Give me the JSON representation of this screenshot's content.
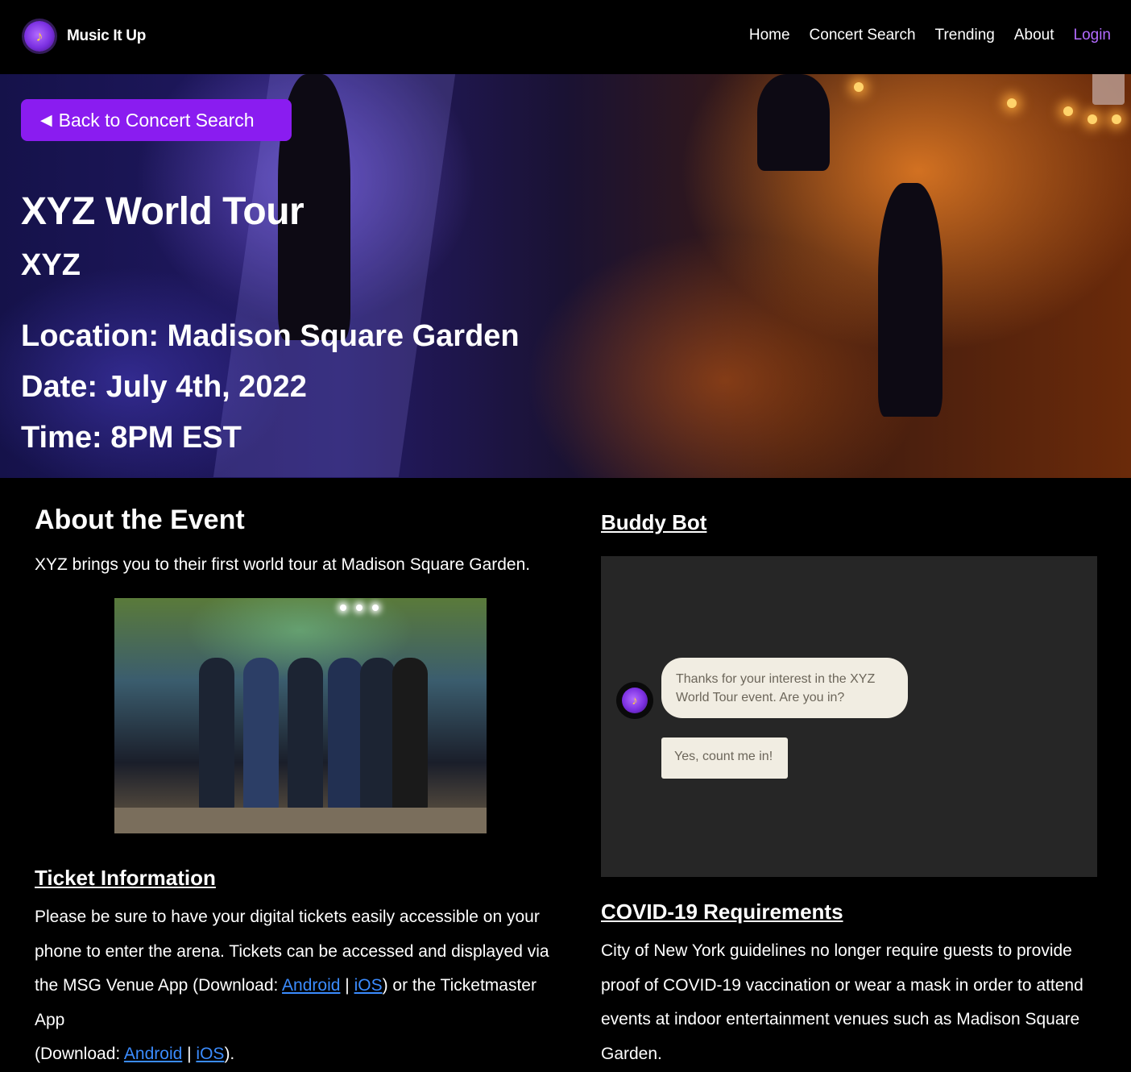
{
  "nav": {
    "brand": "Music It Up",
    "logo_icon": "music-note-icon",
    "links": [
      "Home",
      "Concert Search",
      "Trending",
      "About"
    ],
    "login": "Login"
  },
  "hero": {
    "back_button": "Back to Concert Search",
    "title": "XYZ World Tour",
    "artist": "XYZ",
    "location": "Location: Madison Square Garden",
    "date": "Date: July 4th, 2022",
    "time": "Time: 8PM EST"
  },
  "about": {
    "title": "About the Event",
    "text": "XYZ brings you to their first world tour at Madison Square Garden."
  },
  "tickets": {
    "title": "Ticket Information",
    "text_1": "Please be sure to have your digital tickets easily accessible on your phone to enter the arena. Tickets can be accessed and displayed via the MSG Venue App (Download: ",
    "android_1": "Android",
    "sep_1": " | ",
    "ios_1": "iOS",
    "text_2": ") or the Ticketmaster App",
    "text_3": "(Download: ",
    "android_2": "Android",
    "sep_2": " | ",
    "ios_2": "iOS",
    "text_4": ")."
  },
  "buddy_bot": {
    "title": "Buddy Bot",
    "bot_message": "Thanks for your interest in the XYZ World Tour event. Are you in?",
    "reply_option": "Yes, count me in!"
  },
  "covid": {
    "title": "COVID-19 Requirements",
    "text": "City of New York guidelines no longer require guests to provide proof of COVID-19 vaccination or wear a mask in order to attend events at indoor entertainment venues such as Madison Square Garden."
  },
  "colors": {
    "accent": "#8a1cf0",
    "login": "#b36bff",
    "link": "#3b8cff",
    "chat_panel": "#262626",
    "chat_bubble": "#f1ede2"
  }
}
